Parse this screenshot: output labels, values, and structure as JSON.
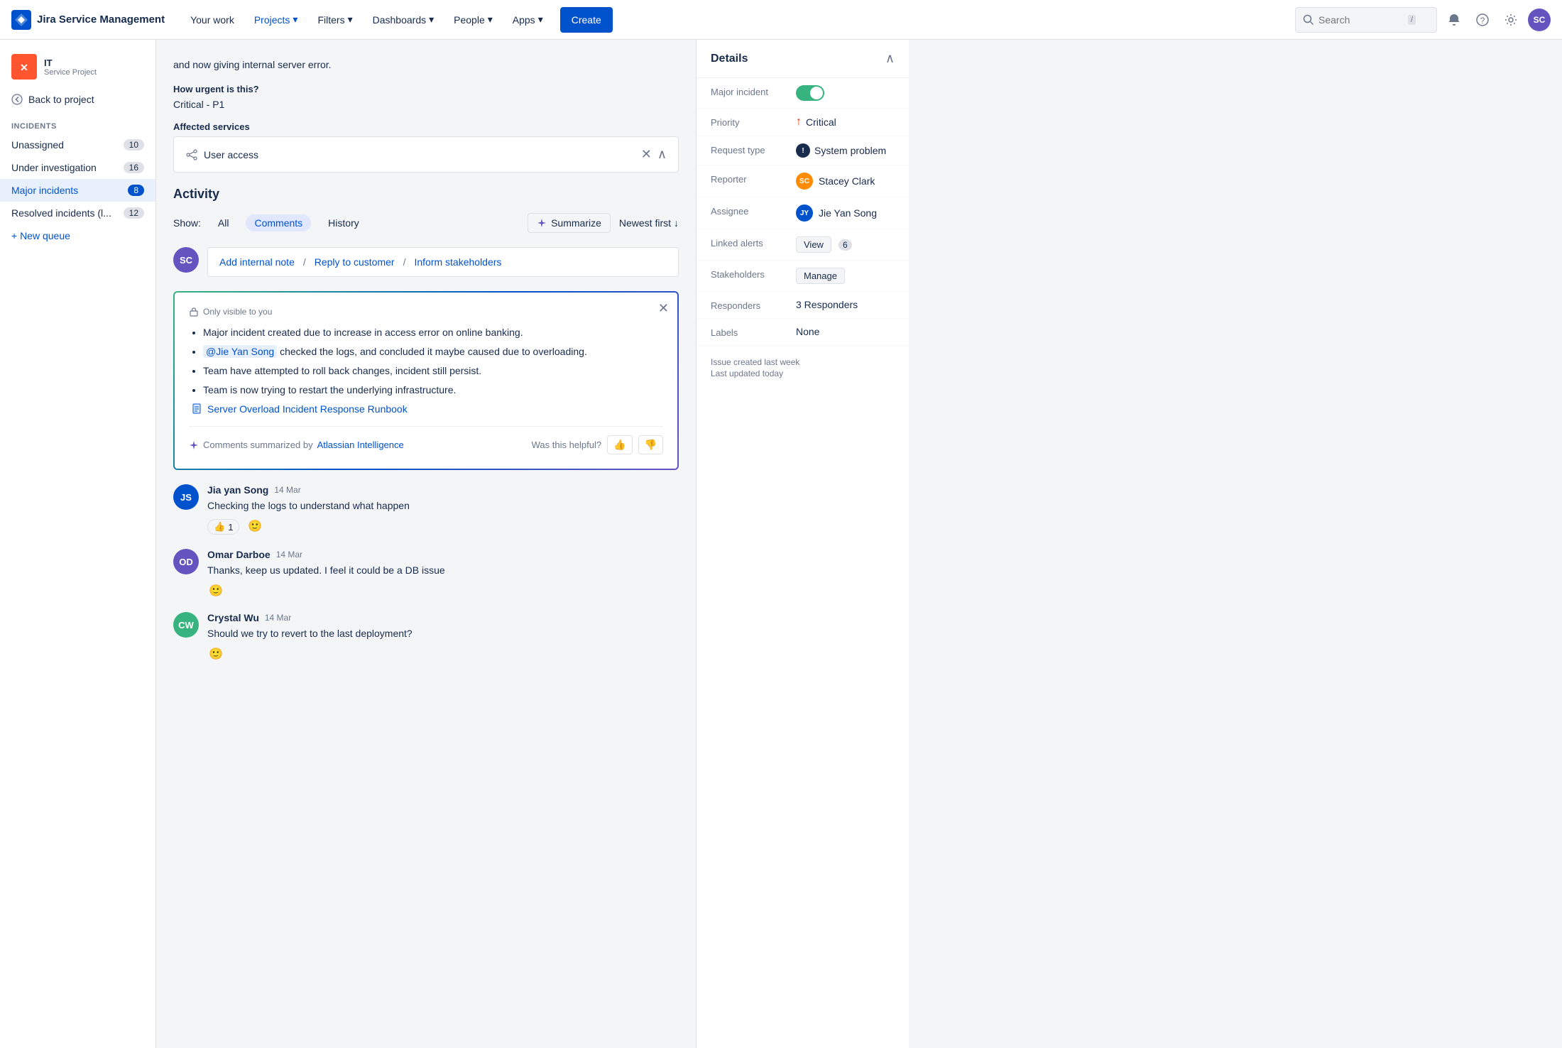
{
  "topnav": {
    "logo_text": "Jira Service Management",
    "nav_items": [
      {
        "id": "your-work",
        "label": "Your work"
      },
      {
        "id": "projects",
        "label": "Projects",
        "has_dropdown": true,
        "active": false
      },
      {
        "id": "filters",
        "label": "Filters",
        "has_dropdown": true
      },
      {
        "id": "dashboards",
        "label": "Dashboards",
        "has_dropdown": true
      },
      {
        "id": "people",
        "label": "People",
        "has_dropdown": true
      },
      {
        "id": "apps",
        "label": "Apps",
        "has_dropdown": true
      }
    ],
    "create_label": "Create",
    "search_placeholder": "Search",
    "search_shortcut": "/"
  },
  "sidebar": {
    "project_name": "IT",
    "project_type": "Service Project",
    "back_label": "Back to project",
    "section_title": "Incidents",
    "items": [
      {
        "id": "unassigned",
        "label": "Unassigned",
        "count": "10"
      },
      {
        "id": "under-investigation",
        "label": "Under investigation",
        "count": "16"
      },
      {
        "id": "major-incidents",
        "label": "Major incidents",
        "count": "8",
        "active": true
      },
      {
        "id": "resolved-incidents",
        "label": "Resolved incidents (l...",
        "count": "12"
      }
    ],
    "new_queue_label": "+ New queue"
  },
  "issue": {
    "description_text": "and now giving internal server error.",
    "urgency_label": "How urgent is this?",
    "urgency_value": "Critical - P1",
    "affected_services_label": "Affected services",
    "affected_service_name": "User access"
  },
  "activity": {
    "title": "Activity",
    "show_label": "Show:",
    "filter_options": [
      {
        "id": "all",
        "label": "All"
      },
      {
        "id": "comments",
        "label": "Comments",
        "active": true
      },
      {
        "id": "history",
        "label": "History"
      }
    ],
    "summarize_label": "Summarize",
    "sort_label": "Newest first",
    "comment_actions": [
      {
        "id": "internal-note",
        "label": "Add internal note"
      },
      {
        "id": "reply-customer",
        "label": "Reply to customer"
      },
      {
        "id": "inform-stakeholders",
        "label": "Inform stakeholders"
      }
    ]
  },
  "summary_box": {
    "visible_badge": "Only visible to you",
    "bullet_1": "Major incident created due to increase in access error on online banking.",
    "bullet_2_prefix": "",
    "bullet_2_mention": "@Jie Yan Song",
    "bullet_2_suffix": " checked the logs, and concluded it maybe caused due to overloading.",
    "bullet_3": "Team have attempted to roll back changes, incident still persist.",
    "bullet_4": "Team is now trying to restart the underlying infrastructure.",
    "doc_link": "Server Overload Incident Response Runbook",
    "footer_left": "Comments summarized by",
    "footer_atlassian": "Atlassian Intelligence",
    "footer_helpful": "Was this helpful?"
  },
  "comments": [
    {
      "id": 1,
      "author": "Jia yan Song",
      "date": "14 Mar",
      "text": "Checking the logs to understand what happen",
      "avatar_color": "#0052cc",
      "initials": "JS",
      "reactions": [
        {
          "emoji": "👍",
          "count": "1"
        }
      ],
      "has_emoji_btn": true
    },
    {
      "id": 2,
      "author": "Omar Darboe",
      "date": "14 Mar",
      "text": "Thanks, keep us updated. I feel it could be a DB issue",
      "avatar_color": "#6554c0",
      "initials": "OD",
      "reactions": [],
      "has_emoji_btn": true
    },
    {
      "id": 3,
      "author": "Crystal Wu",
      "date": "14 Mar",
      "text": "Should we try to revert to the last deployment?",
      "avatar_color": "#36b37e",
      "initials": "CW",
      "reactions": [],
      "has_emoji_btn": true
    }
  ],
  "details": {
    "header": "Details",
    "rows": [
      {
        "id": "major-incident",
        "label": "Major incident",
        "type": "toggle",
        "value": true
      },
      {
        "id": "priority",
        "label": "Priority",
        "type": "priority",
        "value": "Critical"
      },
      {
        "id": "request-type",
        "label": "Request type",
        "type": "request-type",
        "value": "System problem"
      },
      {
        "id": "reporter",
        "label": "Reporter",
        "type": "person",
        "value": "Stacey Clark",
        "avatar_color": "#ff8b00",
        "initials": "SC"
      },
      {
        "id": "assignee",
        "label": "Assignee",
        "type": "person",
        "value": "Jie Yan Song",
        "avatar_color": "#0052cc",
        "initials": "JY"
      },
      {
        "id": "linked-alerts",
        "label": "Linked alerts",
        "type": "view-badge",
        "btn_label": "View",
        "badge": "6"
      },
      {
        "id": "stakeholders",
        "label": "Stakeholders",
        "type": "manage",
        "btn_label": "Manage"
      },
      {
        "id": "responders",
        "label": "Responders",
        "type": "text",
        "value": "3 Responders"
      },
      {
        "id": "labels",
        "label": "Labels",
        "type": "text",
        "value": "None"
      }
    ],
    "created_text": "Issue created last week",
    "updated_text": "Last updated today"
  }
}
